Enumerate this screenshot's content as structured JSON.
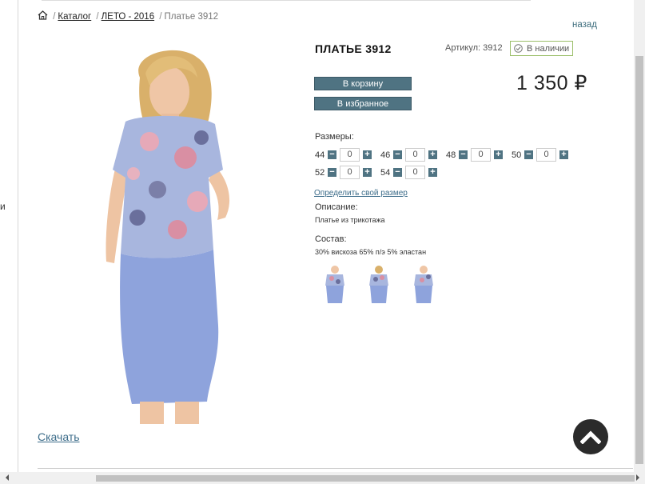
{
  "edge_text": "и",
  "breadcrumb": {
    "items": [
      "Каталог",
      "ЛЕТО - 2016"
    ],
    "current": "Платье 3912"
  },
  "back_link": "назад",
  "download_link": "Скачать",
  "product": {
    "title": "ПЛАТЬЕ 3912",
    "article": "Артикул: 3912",
    "stock": "В наличии",
    "price": "1 350 ₽",
    "cart_button": "В корзину",
    "favorite_button": "В избранное",
    "sizes_label": "Размеры:",
    "sizes": [
      {
        "size": "44",
        "qty": "0"
      },
      {
        "size": "46",
        "qty": "0"
      },
      {
        "size": "48",
        "qty": "0"
      },
      {
        "size": "50",
        "qty": "0"
      },
      {
        "size": "52",
        "qty": "0"
      },
      {
        "size": "54",
        "qty": "0"
      }
    ],
    "size_link": "Определить свой размер",
    "description_label": "Описание:",
    "description": "Платье из трикотажа",
    "composition_label": "Состав:",
    "composition": "30% вискоза 65% п/э 5% эластан"
  },
  "colors": {
    "button_bg": "#4f7382",
    "stock_border": "#9bbf6a",
    "dress_skirt": "#8ea3dc",
    "dress_top": "#a8b6de",
    "scroll_top_bg": "#2b2b2b"
  }
}
